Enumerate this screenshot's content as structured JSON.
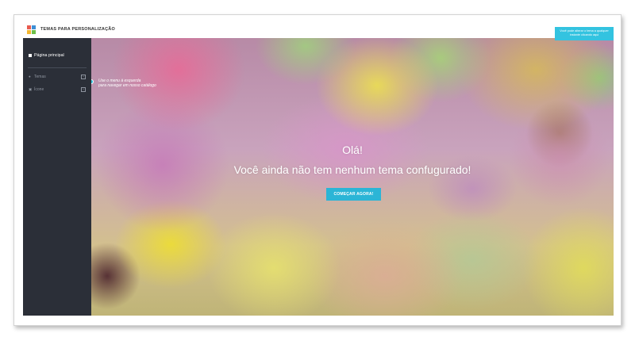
{
  "header": {
    "app_title": "TEMAS PARA PERSONALIZAÇÃO",
    "logo_icon": "colored-squares-logo",
    "tooltip": "Você pode alterar o tema a qualquer instante clicando aqui"
  },
  "sidebar": {
    "home_label": "Página principal",
    "home_icon": "grid-icon",
    "items": [
      {
        "label": "Temas",
        "icon": "drop-icon"
      },
      {
        "label": "Ícone",
        "icon": "image-icon"
      }
    ]
  },
  "main": {
    "hint_line1": "Use o menu à esquerda",
    "hint_line2": "para navegar em nosso catálogo",
    "greeting": "Olá!",
    "headline": "Você ainda não tem nenhum tema confugurado!",
    "cta_label": "COMEÇAR AGORA!"
  },
  "colors": {
    "accent": "#2bb5d6",
    "sidebar_bg": "#2b2f38",
    "logo": [
      "#e95b4e",
      "#3d8fd6",
      "#f5b731",
      "#6cbf4a"
    ]
  }
}
